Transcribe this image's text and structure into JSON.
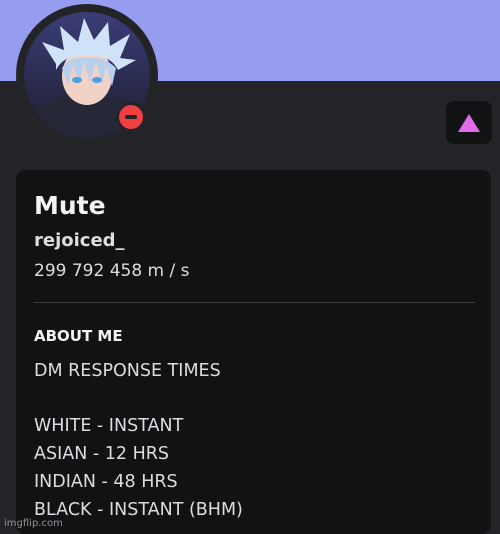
{
  "colors": {
    "banner": "#969CF0",
    "status_dnd": "#F23F43",
    "nitro_triangle": "#E16BE8"
  },
  "profile": {
    "avatar_icon": "anime-avatar-icon",
    "status_icon": "do-not-disturb-status-icon",
    "nitro_icon": "nitro-triangle-icon",
    "display_name": "Mute",
    "username": "rejoiced_",
    "pronouns": "299 792 458 m / s"
  },
  "about": {
    "heading": "ABOUT ME",
    "lines": [
      "DM RESPONSE TIMES",
      "WHITE - INSTANT",
      "ASIAN - 12 HRS",
      "INDIAN - 48 HRS",
      "BLACK - INSTANT (BHM)"
    ]
  },
  "watermark": "imgflip.com"
}
